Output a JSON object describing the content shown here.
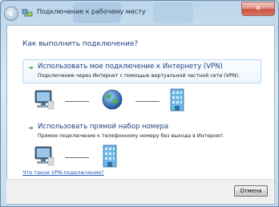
{
  "window": {
    "title": "Подключение к рабочему месту",
    "close_glyph": "✕"
  },
  "main": {
    "question": "Как выполнить подключение?",
    "options": [
      {
        "title": "Использовать мое подключение к Интернету (VPN)",
        "description": "Подключение через Интернет с помощью виртуальной частной сети (VPN).",
        "selected": true
      },
      {
        "title": "Использовать прямой набор номера",
        "description": "Прямое подключение к телефонному номеру без выхода в Интернет.",
        "selected": false
      }
    ],
    "help_link": "Что такое VPN-подключение?"
  },
  "footer": {
    "cancel_label": "Отмена"
  },
  "icons": {
    "back": "back-arrow-icon",
    "title": "network-connection-icon",
    "option_arrow": "green-arrow-icon",
    "computer": "computer-icon",
    "globe": "internet-globe-icon",
    "server": "office-server-icon"
  },
  "colors": {
    "heading": "#1f3f80",
    "link": "#1f5bb8",
    "option_arrow": "#2b9a2b",
    "close_button": "#c9533f"
  }
}
